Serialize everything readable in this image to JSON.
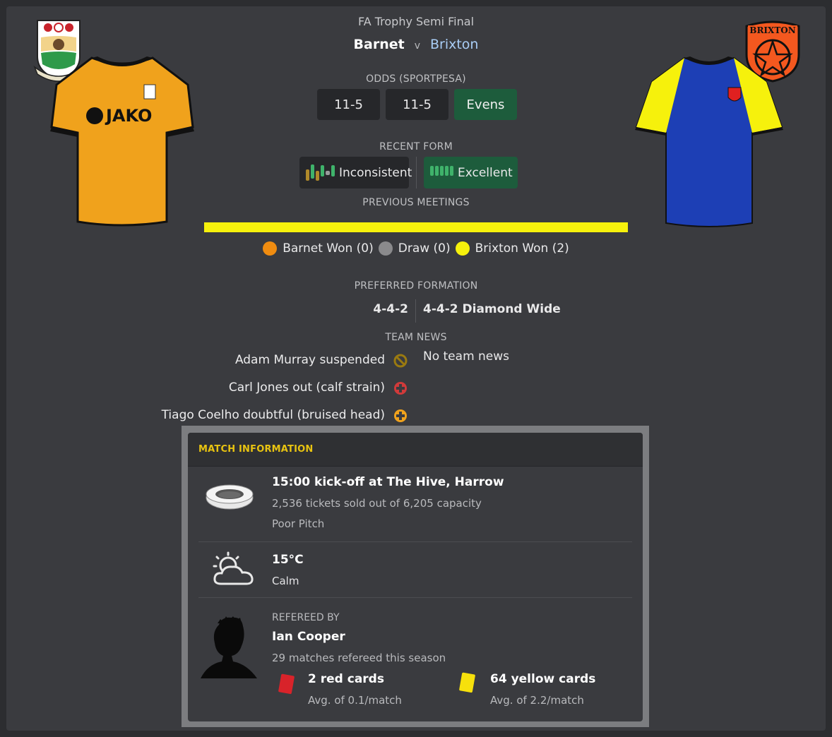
{
  "match": {
    "competition": "FA Trophy Semi Final",
    "home_team": "Barnet",
    "versus": "v",
    "away_team": "Brixton"
  },
  "odds": {
    "label": "ODDS (SPORTPESA)",
    "values": [
      "11-5",
      "11-5",
      "Evens"
    ]
  },
  "recent_form": {
    "label": "RECENT FORM",
    "home": "Inconsistent",
    "away": "Excellent"
  },
  "previous_meetings": {
    "label": "PREVIOUS MEETINGS",
    "home_won": "Barnet Won (0)",
    "draw": "Draw (0)",
    "away_won": "Brixton Won (2)",
    "counts": {
      "home": 0,
      "draw": 0,
      "away": 2
    },
    "colors": {
      "home": "#f08c10",
      "draw": "#8a8a8c",
      "away": "#f6f10c"
    }
  },
  "formation": {
    "label": "PREFERRED FORMATION",
    "home": "4-4-2",
    "away": "4-4-2 Diamond Wide"
  },
  "team_news": {
    "label": "TEAM NEWS",
    "home": [
      {
        "text": "Adam Murray suspended",
        "icon": "suspended-icon"
      },
      {
        "text": "Carl Jones out (calf strain)",
        "icon": "injury-out-icon"
      },
      {
        "text": "Tiago Coelho doubtful (bruised head)",
        "icon": "doubtful-icon"
      }
    ],
    "away": "No team news"
  },
  "match_info": {
    "header": "MATCH INFORMATION",
    "venue_title": "15:00 kick-off at The Hive, Harrow",
    "tickets": "2,536 tickets sold out of 6,205 capacity",
    "pitch": "Poor Pitch",
    "temperature": "15°C",
    "wind": "Calm",
    "referee_label": "REFEREED BY",
    "referee_name": "Ian Cooper",
    "referee_matches": "29 matches refereed this season",
    "red_cards": "2 red cards",
    "red_avg": "Avg. of 0.1/match",
    "yellow_cards": "64 yellow cards",
    "yellow_avg": "Avg. of 2.2/match"
  },
  "crests": {
    "away_crest_text": "BRIXTON",
    "home_kit_brand": "JAKO"
  },
  "colors": {
    "accent_green": "#1d5c3c",
    "header_yellow": "#e8c311",
    "away_link": "#a9cdf5"
  }
}
